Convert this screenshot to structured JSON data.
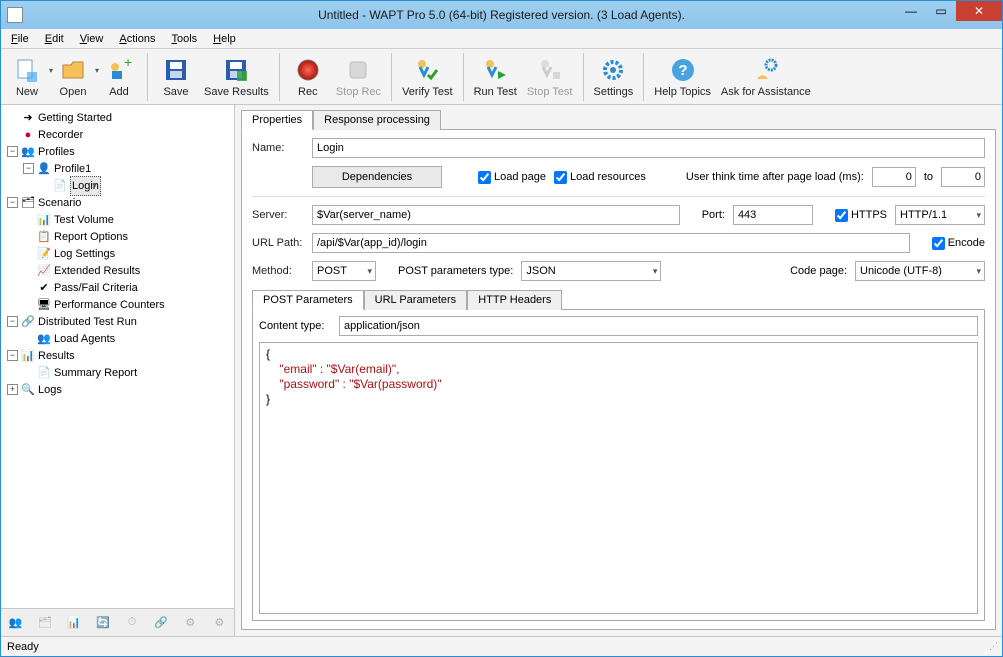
{
  "window": {
    "title": "Untitled - WAPT Pro 5.0 (64-bit) Registered version. (3 Load Agents)."
  },
  "menu": {
    "file": "File",
    "edit": "Edit",
    "view": "View",
    "actions": "Actions",
    "tools": "Tools",
    "help": "Help"
  },
  "toolbar": {
    "new": "New",
    "open": "Open",
    "add": "Add",
    "save": "Save",
    "saveResults": "Save Results",
    "rec": "Rec",
    "stopRec": "Stop Rec",
    "verify": "Verify Test",
    "run": "Run Test",
    "stopTest": "Stop Test",
    "settings": "Settings",
    "help": "Help Topics",
    "ask": "Ask for Assistance"
  },
  "tree": {
    "gettingStarted": "Getting Started",
    "recorder": "Recorder",
    "profiles": "Profiles",
    "profile1": "Profile1",
    "login": "Login",
    "scenario": "Scenario",
    "testVolume": "Test Volume",
    "reportOptions": "Report Options",
    "logSettings": "Log Settings",
    "extResults": "Extended Results",
    "passFail": "Pass/Fail Criteria",
    "perfCounters": "Performance Counters",
    "distRun": "Distributed Test Run",
    "loadAgents": "Load Agents",
    "results": "Results",
    "summary": "Summary Report",
    "logs": "Logs"
  },
  "props": {
    "tabProperties": "Properties",
    "tabResponse": "Response processing",
    "nameLabel": "Name:",
    "nameValue": "Login",
    "dependencies": "Dependencies",
    "loadPage": "Load page",
    "loadResources": "Load resources",
    "thinkLabel": "User think time after page load (ms):",
    "thinkFrom": "0",
    "to": "to",
    "thinkTo": "0",
    "serverLabel": "Server:",
    "serverValue": "$Var(server_name)",
    "portLabel": "Port:",
    "portValue": "443",
    "httpsLabel": "HTTPS",
    "httpVersion": "HTTP/1.1",
    "urlLabel": "URL Path:",
    "urlValue": "/api/$Var(app_id)/login",
    "encodeLabel": "Encode",
    "methodLabel": "Method:",
    "methodValue": "POST",
    "postParamsTypeLabel": "POST parameters type:",
    "postParamsTypeValue": "JSON",
    "codePageLabel": "Code page:",
    "codePageValue": "Unicode (UTF-8)",
    "subPostParams": "POST Parameters",
    "subUrlParams": "URL Parameters",
    "subHttpHeaders": "HTTP Headers",
    "contentTypeLabel": "Content type:",
    "contentTypeValue": "application/json",
    "body_open": "{",
    "body_close": "}",
    "body_l1": "    \"email\" : \"$Var(email)\",",
    "body_l2": "    \"password\" : \"$Var(password)\""
  },
  "status": {
    "ready": "Ready"
  }
}
